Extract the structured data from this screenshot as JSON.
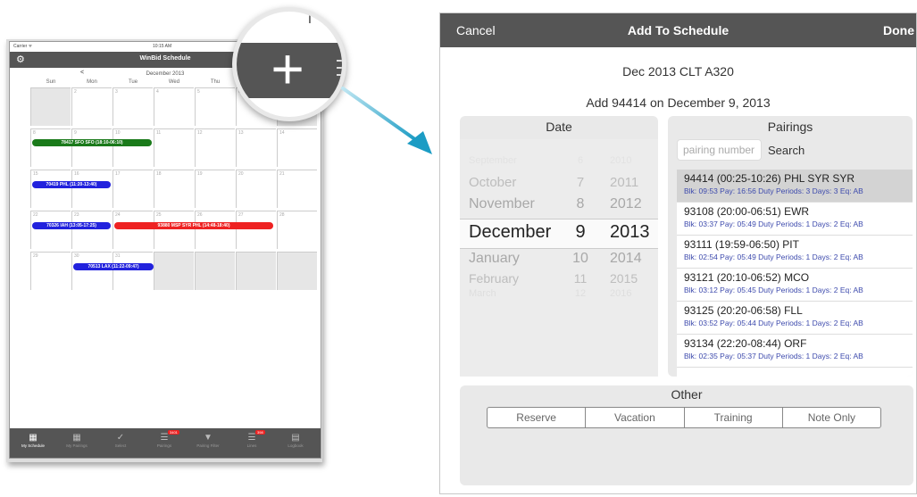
{
  "ipad": {
    "carrier": "Carrier ᯤ",
    "time": "10:15 AM",
    "nav_title": "WinBid Schedule",
    "gear_icon": "gear-icon",
    "prev_arrow": "<",
    "month_label": "December 2013",
    "weekdays": [
      "Sun",
      "Mon",
      "Tue",
      "Wed",
      "Thu"
    ],
    "dates": [
      "2",
      "3",
      "4",
      "5",
      "6",
      "",
      "8",
      "9",
      "10",
      "11",
      "12",
      "13",
      "14",
      "15",
      "16",
      "17",
      "18",
      "19",
      "20",
      "21",
      "22",
      "23",
      "24",
      "25",
      "26",
      "27",
      "28",
      "29",
      "30",
      "31"
    ],
    "events": [
      {
        "label": "78417 SFO SFO (18:10-06:10)",
        "color": "#1a7a1a"
      },
      {
        "label": "70419 PHL (11:20-13:40)",
        "color": "#2222dd"
      },
      {
        "label": "70326 IAH (13:05-17:25)",
        "color": "#2222dd"
      },
      {
        "label": "93880 MSP SYR PHL (14:48-18:40)",
        "color": "#ee2222"
      },
      {
        "label": "70513 LAX (11:22-09:47)",
        "color": "#2222dd"
      }
    ],
    "tabs": [
      {
        "label": "My Schedule",
        "icon": "schedule-icon"
      },
      {
        "label": "My Pairings",
        "icon": "pairings-icon"
      },
      {
        "label": "Select",
        "icon": "checkmark-icon"
      },
      {
        "label": "Pairings",
        "icon": "list-icon",
        "badge": "3401"
      },
      {
        "label": "Pairing Filter",
        "icon": "filter-icon"
      },
      {
        "label": "Lines",
        "icon": "lines-icon",
        "badge": "398"
      },
      {
        "label": "Logbook",
        "icon": "logbook-icon"
      }
    ]
  },
  "magnifier": {
    "symbol": "+",
    "corner_text": "I"
  },
  "popup": {
    "cancel": "Cancel",
    "title": "Add To Schedule",
    "done": "Done",
    "subtitle": "Dec 2013 CLT A320",
    "add_line": "Add 94414 on December 9, 2013",
    "date_header": "Date",
    "picker": {
      "months": [
        "September",
        "October",
        "November",
        "December",
        "January",
        "February",
        "March"
      ],
      "days": [
        "6",
        "7",
        "8",
        "9",
        "10",
        "11",
        "12"
      ],
      "years": [
        "2010",
        "2011",
        "2012",
        "2013",
        "2014",
        "2015",
        "2016"
      ],
      "selected_index": 3
    },
    "pairings_header": "Pairings",
    "search_placeholder": "pairing number",
    "search_label": "Search",
    "pairings": [
      {
        "line1": "94414  (00:25-10:26)  PHL SYR SYR",
        "line2": "Blk: 09:53  Pay: 16:56  Duty Periods: 3 Days: 3 Eq: AB",
        "selected": true
      },
      {
        "line1": "93108  (20:00-06:51)  EWR",
        "line2": "Blk: 03:37  Pay: 05:49  Duty Periods: 1 Days: 2 Eq: AB"
      },
      {
        "line1": "93111  (19:59-06:50)  PIT",
        "line2": "Blk: 02:54  Pay: 05:49  Duty Periods: 1 Days: 2 Eq: AB"
      },
      {
        "line1": "93121  (20:10-06:52)  MCO",
        "line2": "Blk: 03:12  Pay: 05:45  Duty Periods: 1 Days: 2 Eq: AB"
      },
      {
        "line1": "93125  (20:20-06:58)  FLL",
        "line2": "Blk: 03:52  Pay: 05:44  Duty Periods: 1 Days: 2 Eq: AB"
      },
      {
        "line1": "93134  (22:20-08:44)  ORF",
        "line2": "Blk: 02:35  Pay: 05:37  Duty Periods: 1 Days: 2 Eq: AB"
      }
    ],
    "other_header": "Other",
    "other_options": [
      "Reserve",
      "Vacation",
      "Training",
      "Note Only"
    ]
  }
}
